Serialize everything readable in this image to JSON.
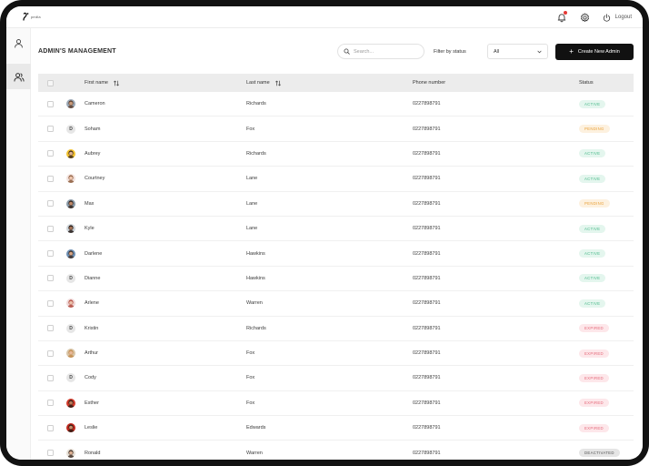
{
  "app": {
    "logo_text": "pedla",
    "logout_label": "Logout"
  },
  "page": {
    "title": "ADMIN'S MANAGEMENT"
  },
  "toolbar": {
    "search_placeholder": "Search...",
    "filter_label": "Filter by status",
    "filter_value": "All",
    "create_label": "Create New Admin"
  },
  "table": {
    "headers": {
      "first_name": "First name",
      "last_name": "Last name",
      "phone": "Phone number",
      "status": "Status"
    },
    "rows": [
      {
        "first": "Cameron",
        "last": "Richards",
        "phone": "0227898791",
        "status": "ACTIVE",
        "status_kind": "active",
        "avatar": {
          "type": "photo",
          "skin": "#c99a7a",
          "hair": "#5a3b2a",
          "bg": "#9aa7b5"
        }
      },
      {
        "first": "Soham",
        "last": "Fox",
        "phone": "0227898791",
        "status": "PENDING",
        "status_kind": "pending",
        "avatar": {
          "type": "letter",
          "letter": "D"
        }
      },
      {
        "first": "Aubrey",
        "last": "Richards",
        "phone": "0227898791",
        "status": "ACTIVE",
        "status_kind": "active",
        "avatar": {
          "type": "photo",
          "skin": "#e0b28f",
          "hair": "#3a2418",
          "bg": "#f2c230"
        }
      },
      {
        "first": "Courtney",
        "last": "Lane",
        "phone": "0227898791",
        "status": "ACTIVE",
        "status_kind": "active",
        "avatar": {
          "type": "photo",
          "skin": "#efc7b0",
          "hair": "#8a5a3a",
          "bg": "#f3e3df"
        }
      },
      {
        "first": "Max",
        "last": "Lane",
        "phone": "0227898791",
        "status": "PENDING",
        "status_kind": "pending",
        "avatar": {
          "type": "photo",
          "skin": "#c08a6a",
          "hair": "#2e1e16",
          "bg": "#8a9aa8"
        }
      },
      {
        "first": "Kyle",
        "last": "Lane",
        "phone": "0227898791",
        "status": "ACTIVE",
        "status_kind": "active",
        "avatar": {
          "type": "photo",
          "skin": "#a47356",
          "hair": "#1e1410",
          "bg": "#cfd5da"
        }
      },
      {
        "first": "Darlene",
        "last": "Hawkins",
        "phone": "0227898791",
        "status": "ACTIVE",
        "status_kind": "active",
        "avatar": {
          "type": "photo",
          "skin": "#d7a585",
          "hair": "#3b2a22",
          "bg": "#6d8fb3"
        }
      },
      {
        "first": "Dianne",
        "last": "Hawkins",
        "phone": "0227898791",
        "status": "ACTIVE",
        "status_kind": "active",
        "avatar": {
          "type": "letter",
          "letter": "D"
        }
      },
      {
        "first": "Arlene",
        "last": "Warren",
        "phone": "0227898791",
        "status": "ACTIVE",
        "status_kind": "active",
        "avatar": {
          "type": "photo",
          "skin": "#ecc2ad",
          "hair": "#b0473a",
          "bg": "#f0dada"
        }
      },
      {
        "first": "Kristin",
        "last": "Richards",
        "phone": "0227898791",
        "status": "EXPIRED",
        "status_kind": "expired",
        "avatar": {
          "type": "letter",
          "letter": "D"
        }
      },
      {
        "first": "Arthur",
        "last": "Fox",
        "phone": "0227898791",
        "status": "EXPIRED",
        "status_kind": "expired",
        "avatar": {
          "type": "photo",
          "skin": "#e8b99a",
          "hair": "#c28a4a",
          "bg": "#d9c6a9"
        }
      },
      {
        "first": "Cody",
        "last": "Fox",
        "phone": "0227898791",
        "status": "EXPIRED",
        "status_kind": "expired",
        "avatar": {
          "type": "letter",
          "letter": "D"
        }
      },
      {
        "first": "Esther",
        "last": "Fox",
        "phone": "0227898791",
        "status": "EXPIRED",
        "status_kind": "expired",
        "avatar": {
          "type": "photo",
          "skin": "#b77a5a",
          "hair": "#2a1a12",
          "bg": "#d23b2c"
        }
      },
      {
        "first": "Leslie",
        "last": "Edwards",
        "phone": "0227898791",
        "status": "EXPIRED",
        "status_kind": "expired",
        "avatar": {
          "type": "photo",
          "skin": "#c7906e",
          "hair": "#2b1a12",
          "bg": "#c0281d"
        }
      },
      {
        "first": "Ronald",
        "last": "Warren",
        "phone": "0227898791",
        "status": "DEACTIVATED",
        "status_kind": "deactivated",
        "avatar": {
          "type": "photo",
          "skin": "#ddb093",
          "hair": "#3c2c22",
          "bg": "#e8e1d8"
        }
      }
    ]
  },
  "colors": {
    "active_text": "#49b98a",
    "pending_text": "#e9a23b",
    "expired_text": "#e66b7c",
    "deactivated_text": "#555555",
    "primary_button": "#111111"
  },
  "icons": {
    "notification": "bell-icon",
    "settings": "gear-icon",
    "logout": "power-icon",
    "sidebar_profile": "user-icon",
    "sidebar_admins": "users-icon",
    "search": "search-icon",
    "sort": "sort-icon",
    "dropdown": "chevron-down-icon",
    "create": "plus-icon"
  }
}
